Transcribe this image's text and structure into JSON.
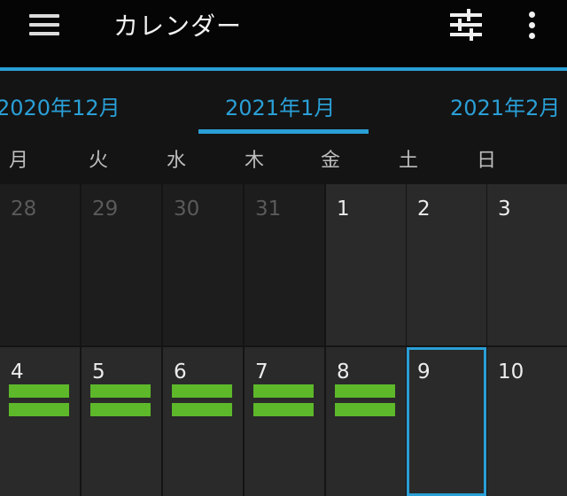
{
  "header": {
    "title": "カレンダー",
    "menu_icon": "hamburger-menu-icon",
    "filter_icon": "sliders-icon",
    "more_icon": "more-vert-icon"
  },
  "months": {
    "prev": "2020年12月",
    "current": "2021年1月",
    "next": "2021年2月"
  },
  "weekdays": [
    "月",
    "火",
    "水",
    "木",
    "金",
    "土",
    "日"
  ],
  "weeks": [
    [
      {
        "day": "28",
        "in_month": false
      },
      {
        "day": "29",
        "in_month": false
      },
      {
        "day": "30",
        "in_month": false
      },
      {
        "day": "31",
        "in_month": false
      },
      {
        "day": "1",
        "in_month": true
      },
      {
        "day": "2",
        "in_month": true
      },
      {
        "day": "3",
        "in_month": true
      }
    ],
    [
      {
        "day": "4",
        "in_month": true,
        "events": 2
      },
      {
        "day": "5",
        "in_month": true,
        "events": 2
      },
      {
        "day": "6",
        "in_month": true,
        "events": 2
      },
      {
        "day": "7",
        "in_month": true,
        "events": 2
      },
      {
        "day": "8",
        "in_month": true,
        "events": 2
      },
      {
        "day": "9",
        "in_month": true,
        "today": true
      },
      {
        "day": "10",
        "in_month": true
      }
    ]
  ],
  "colors": {
    "accent": "#2a9fd6",
    "event": "#5db82a",
    "appbar": "#050505",
    "cell_in_month": "#2a2a2a",
    "cell_out_month": "#1d1d1d"
  }
}
